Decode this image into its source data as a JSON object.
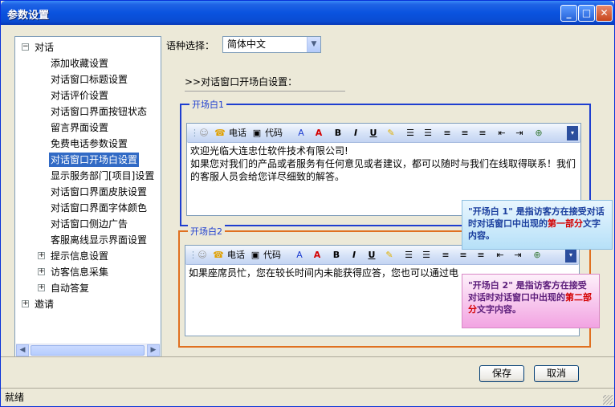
{
  "window": {
    "title": "参数设置"
  },
  "tree": {
    "root1": "对话",
    "children": [
      "添加收藏设置",
      "对话窗口标题设置",
      "对话评价设置",
      "对话窗口界面按钮状态",
      "留言界面设置",
      "免费电话参数设置",
      "对话窗口开场白设置",
      "显示服务部门[项目]设置",
      "对话窗口界面皮肤设置",
      "对话窗口界面字体颜色",
      "对话窗口侧边广告",
      "客服离线显示界面设置"
    ],
    "groups": [
      "提示信息设置",
      "访客信息采集",
      "自动答复"
    ],
    "root2": "邀请",
    "selected_index": 6
  },
  "language": {
    "label": "语种选择：",
    "value": "简体中文"
  },
  "section_title": ">>对话窗口开场白设置：",
  "opening1": {
    "legend": "开场白1",
    "text": "欢迎光临大连忠仕软件技术有限公司!\n如果您对我们的产品或者服务有任何意见或者建议，都可以随时与我们在线取得联系！我们的客服人员会给您详尽细致的解答。"
  },
  "opening2": {
    "legend": "开场白2",
    "text": "如果座席员忙，您在较长时间内未能获得应答，您也可以通过电"
  },
  "toolbar": {
    "phone": "电话",
    "code": "代码",
    "bold": "B",
    "italic": "I",
    "underline": "U"
  },
  "tips": {
    "tip1_a": "\"开场白 1\" ",
    "tip1_b": "是指访客方在接受对话时对话窗口中出现的",
    "tip1_c": "第一部分",
    "tip1_d": "文字内容。",
    "tip2_a": "\"开场白 2\" ",
    "tip2_b": "是指访客方在接受对话时对话窗口中出现的",
    "tip2_c": "第二部分",
    "tip2_d": "文字内容。"
  },
  "buttons": {
    "save": "保存",
    "cancel": "取消"
  },
  "status": "就绪"
}
